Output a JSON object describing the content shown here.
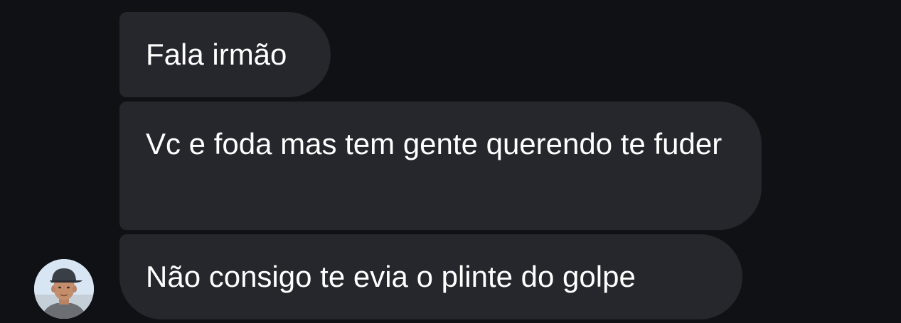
{
  "conversation": {
    "messages": [
      {
        "text": "Fala irmão"
      },
      {
        "text": "Vc e foda mas tem gente querendo te fuder"
      },
      {
        "text": "Não consigo te evia o plinte do golpe"
      }
    ],
    "sender_avatar_icon": "person-photo-avatar"
  },
  "colors": {
    "background": "#0f1115",
    "bubble": "#26272c",
    "text": "#ffffff"
  }
}
